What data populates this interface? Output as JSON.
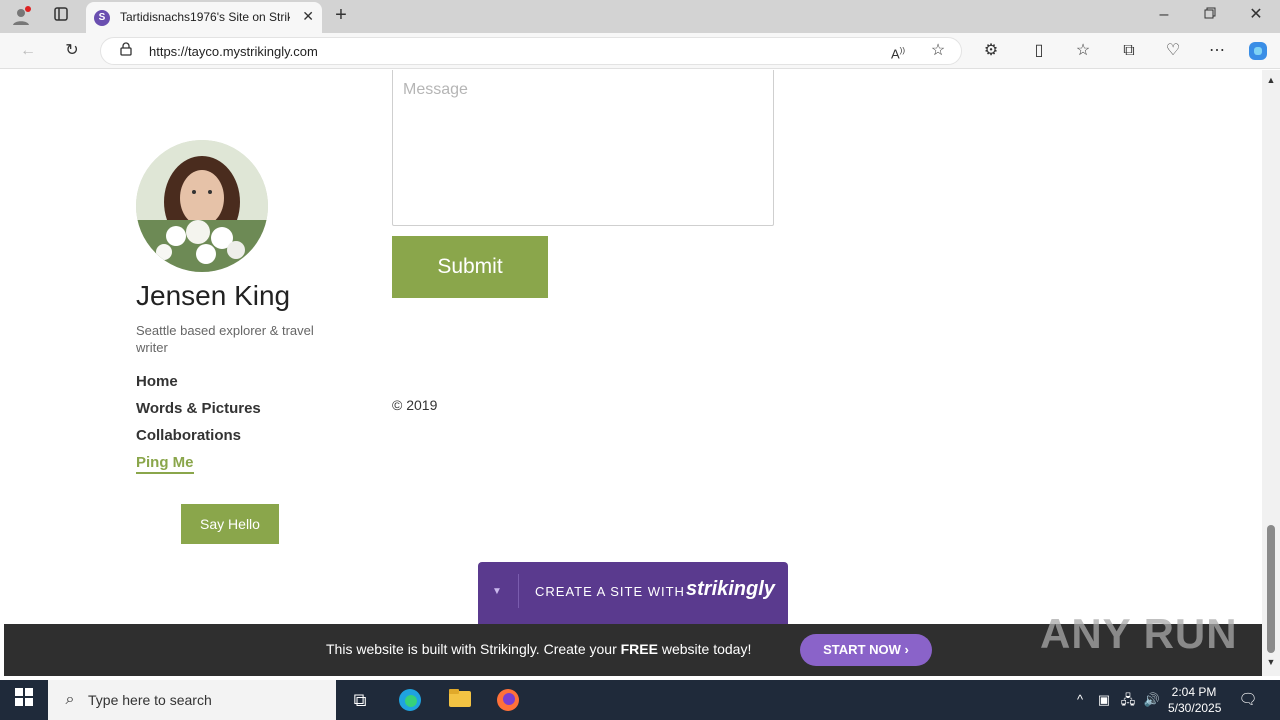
{
  "browser": {
    "tab_title": "Tartidisnachs1976's Site on Strikingly",
    "tab_favicon": "S",
    "url": "https://tayco.mystrikingly.com"
  },
  "form": {
    "message_placeholder": "Message",
    "submit_label": "Submit"
  },
  "profile": {
    "name": "Jensen King",
    "tagline": "Seattle based explorer & travel writer"
  },
  "nav": {
    "items": [
      {
        "label": "Home"
      },
      {
        "label": "Words & Pictures"
      },
      {
        "label": "Collaborations"
      },
      {
        "label": "Ping Me"
      }
    ],
    "active_index": 3
  },
  "say_hello_label": "Say Hello",
  "copyright": "© 2019",
  "badge": {
    "text": "CREATE A SITE WITH",
    "brand": "strikingly"
  },
  "footer": {
    "text_a": "This website is built with Strikingly.  Create your ",
    "text_bold": "FREE",
    "text_b": " website today!",
    "cta": "START NOW"
  },
  "watermark": "ANY RUN",
  "taskbar": {
    "search_placeholder": "Type here to search",
    "time": "2:04 PM",
    "date": "5/30/2025"
  },
  "colors": {
    "accent": "#8aa64b",
    "badge": "#5a3a8e",
    "cta": "#8a63c9"
  }
}
